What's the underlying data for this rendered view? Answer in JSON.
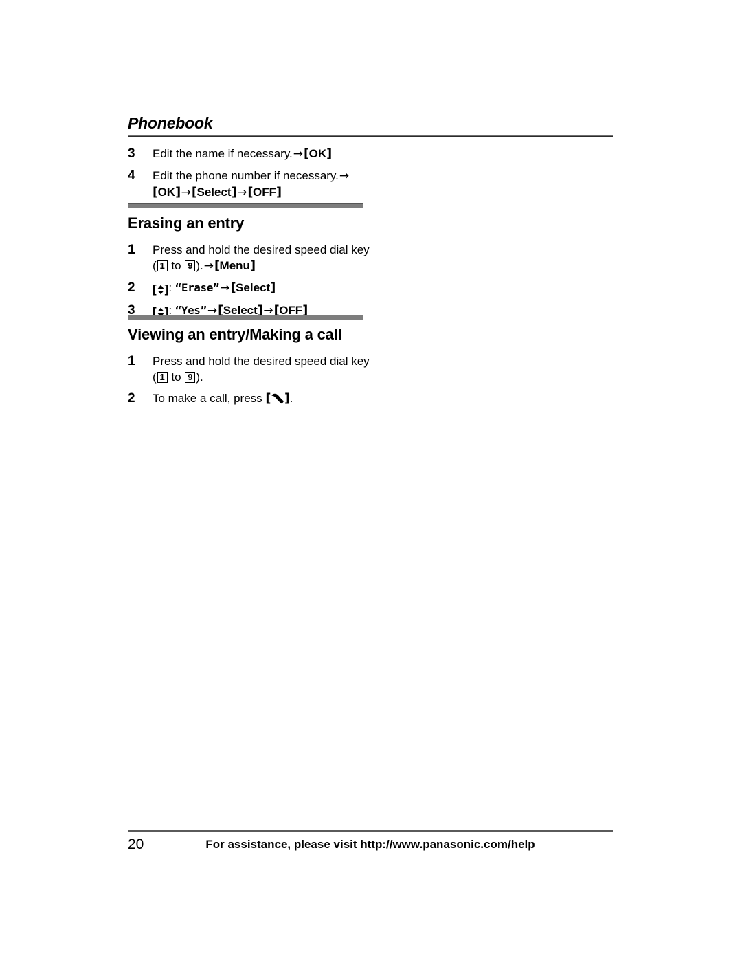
{
  "document": {
    "running_head": "Phonebook",
    "page_number": "20",
    "footer_note": "For assistance, please visit http://www.panasonic.com/help"
  },
  "continued_steps": [
    {
      "number": "3",
      "text_before": "Edit the name if necessary.",
      "arrow": "→",
      "key": "[OK]"
    },
    {
      "number": "4",
      "text_before": "Edit the phone number if necessary.",
      "arrow": "→",
      "keys": [
        "[OK]",
        "[Select]",
        "[OFF]"
      ]
    }
  ],
  "sections": [
    {
      "title": "Erasing an entry",
      "steps": [
        {
          "number": "1",
          "text": "Press and hold the desired speed dial key",
          "range_open": "(",
          "key_from": "1",
          "range_mid": "to",
          "key_to": "9",
          "range_close": ").",
          "arrow": "→",
          "softkey": "[Menu]"
        },
        {
          "number": "2",
          "nav_icon": "navigator-up-down-icon",
          "colon": ":",
          "display_text": "“Erase”",
          "arrow": "→",
          "softkey": "[Select]"
        },
        {
          "number": "3",
          "nav_icon": "navigator-up-down-icon",
          "colon": ":",
          "display_text": "“Yes”",
          "arrow": "→",
          "softkey": "[Select]",
          "arrow2": "→",
          "softkey2": "[OFF]"
        }
      ]
    },
    {
      "title": "Viewing an entry/Making a call",
      "steps": [
        {
          "number": "1",
          "text": "Press and hold the desired speed dial key",
          "range_open": "(",
          "key_from": "1",
          "range_mid": "to",
          "key_to": "9",
          "range_close": ")."
        },
        {
          "number": "2",
          "text": "To make a call, press",
          "handset_icon": "handset-call-icon",
          "period": "."
        }
      ]
    }
  ],
  "labels": {
    "bracket_open": "[",
    "bracket_close": "]"
  }
}
